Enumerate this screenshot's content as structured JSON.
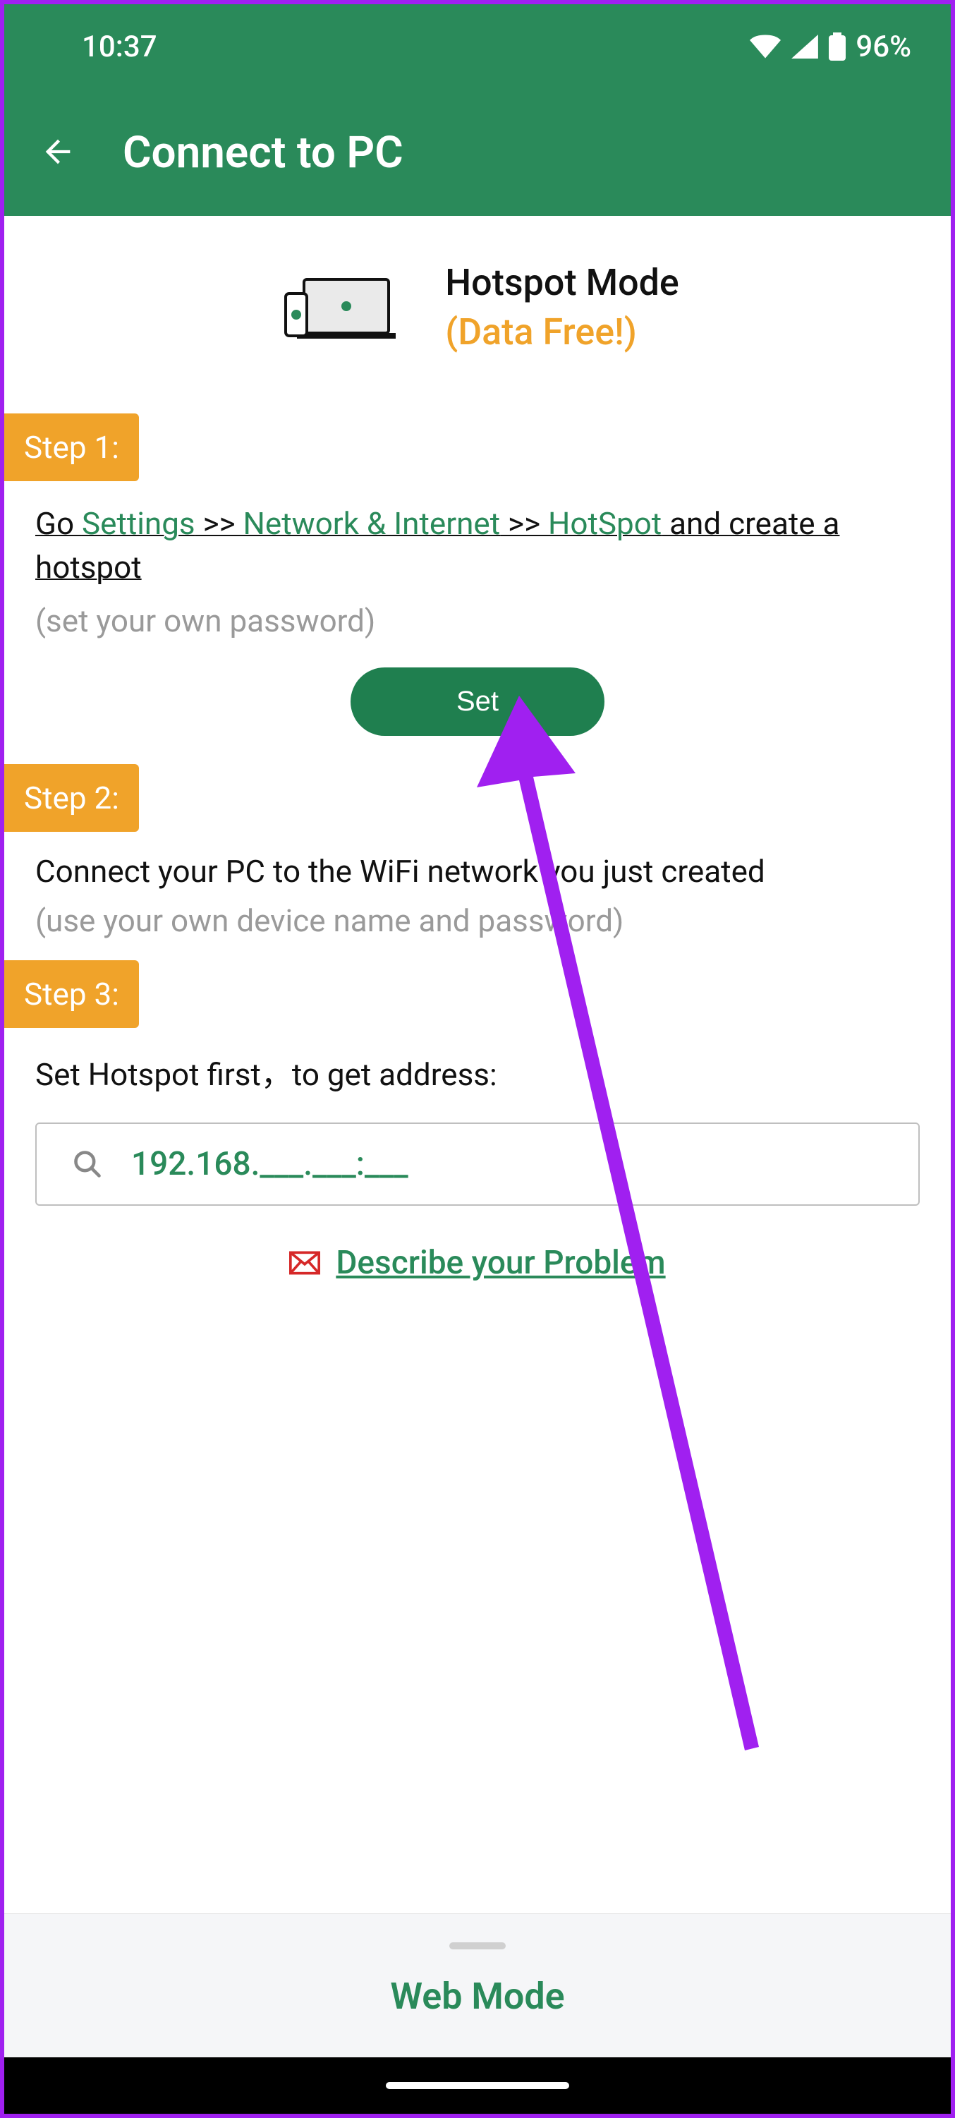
{
  "status_bar": {
    "time": "10:37",
    "battery_text": "96%"
  },
  "app_bar": {
    "title": "Connect to PC"
  },
  "hero": {
    "title": "Hotspot Mode",
    "subtitle": "(Data Free!)"
  },
  "steps": {
    "s1": {
      "badge": "Step 1:",
      "instr_go": "Go ",
      "instr_settings": "Settings",
      "instr_arrow1": " >> ",
      "instr_network": "Network & Internet",
      "instr_arrow2": " >> ",
      "instr_hotspot": "HotSpot",
      "instr_tail": " and create a hotspot",
      "sub": "(set your own password)",
      "set_btn": "Set"
    },
    "s2": {
      "badge": "Step 2:",
      "instr": "Connect your PC to the WiFi network you just created",
      "sub": "(use your own device name and password)"
    },
    "s3": {
      "badge": "Step 3:",
      "instr": "Set Hotspot first，to get address:",
      "addr": "192.168.___.___:___"
    }
  },
  "problem_link": "Describe your Problem",
  "bottom_panel": {
    "label": "Web Mode"
  }
}
